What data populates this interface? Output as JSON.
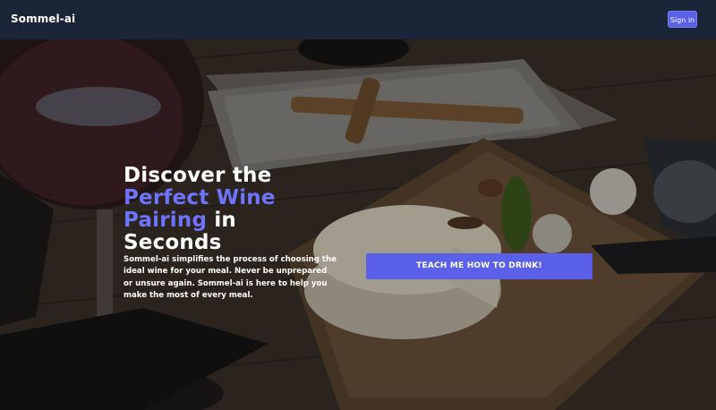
{
  "navbar": {
    "brand": "Sommel-ai",
    "signin_label": "Sign in"
  },
  "hero": {
    "headline_line1": "Discover the",
    "headline_accent1": "Perfect Wine",
    "headline_accent2": "Pairing",
    "headline_line3_rest": " in",
    "headline_line4": "Seconds",
    "description": "Sommel-ai simplifies the process of choosing the ideal wine for your meal. Never be unprepared or unsure again. Sommel-ai is here to help you make the most of every meal.",
    "cta_label": "TEACH ME HOW TO DRINK!"
  },
  "colors": {
    "navbar_bg": "#1b2538",
    "accent": "#5b60e8",
    "headline_accent": "#6e74ff"
  }
}
